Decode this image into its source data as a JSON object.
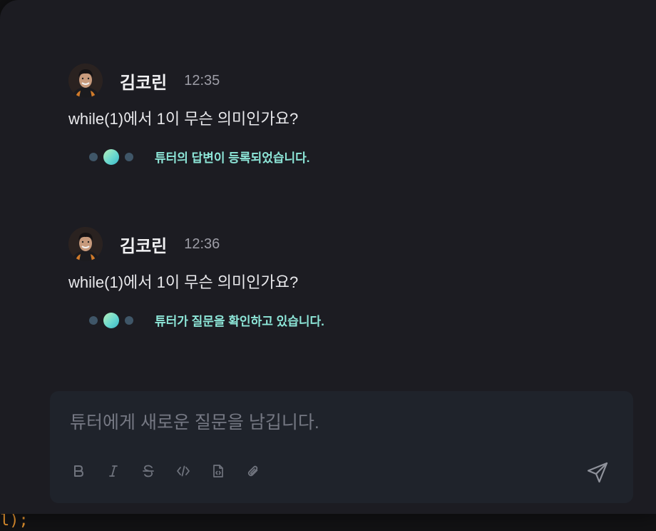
{
  "backdrop": {
    "code_fragment": "l);"
  },
  "messages": [
    {
      "author": "김코린",
      "time": "12:35",
      "text": "while(1)에서 1이 무슨 의미인가요?",
      "status": "튜터의 답변이 등록되었습니다."
    },
    {
      "author": "김코린",
      "time": "12:36",
      "text": "while(1)에서 1이 무슨 의미인가요?",
      "status": "튜터가 질문을 확인하고 있습니다."
    }
  ],
  "composer": {
    "placeholder": "튜터에게 새로운 질문을 남깁니다.",
    "value": "",
    "tools": [
      "bold-icon",
      "italic-icon",
      "strikethrough-icon",
      "code-icon",
      "code-file-icon",
      "attachment-icon"
    ],
    "send_icon": "send-icon"
  },
  "colors": {
    "status_text": "#8de6d8",
    "status_dot_gradient": [
      "#b7f0b8",
      "#39b8c9"
    ],
    "panel_bg": "#1c1c22",
    "composer_bg": "#1f232b"
  }
}
